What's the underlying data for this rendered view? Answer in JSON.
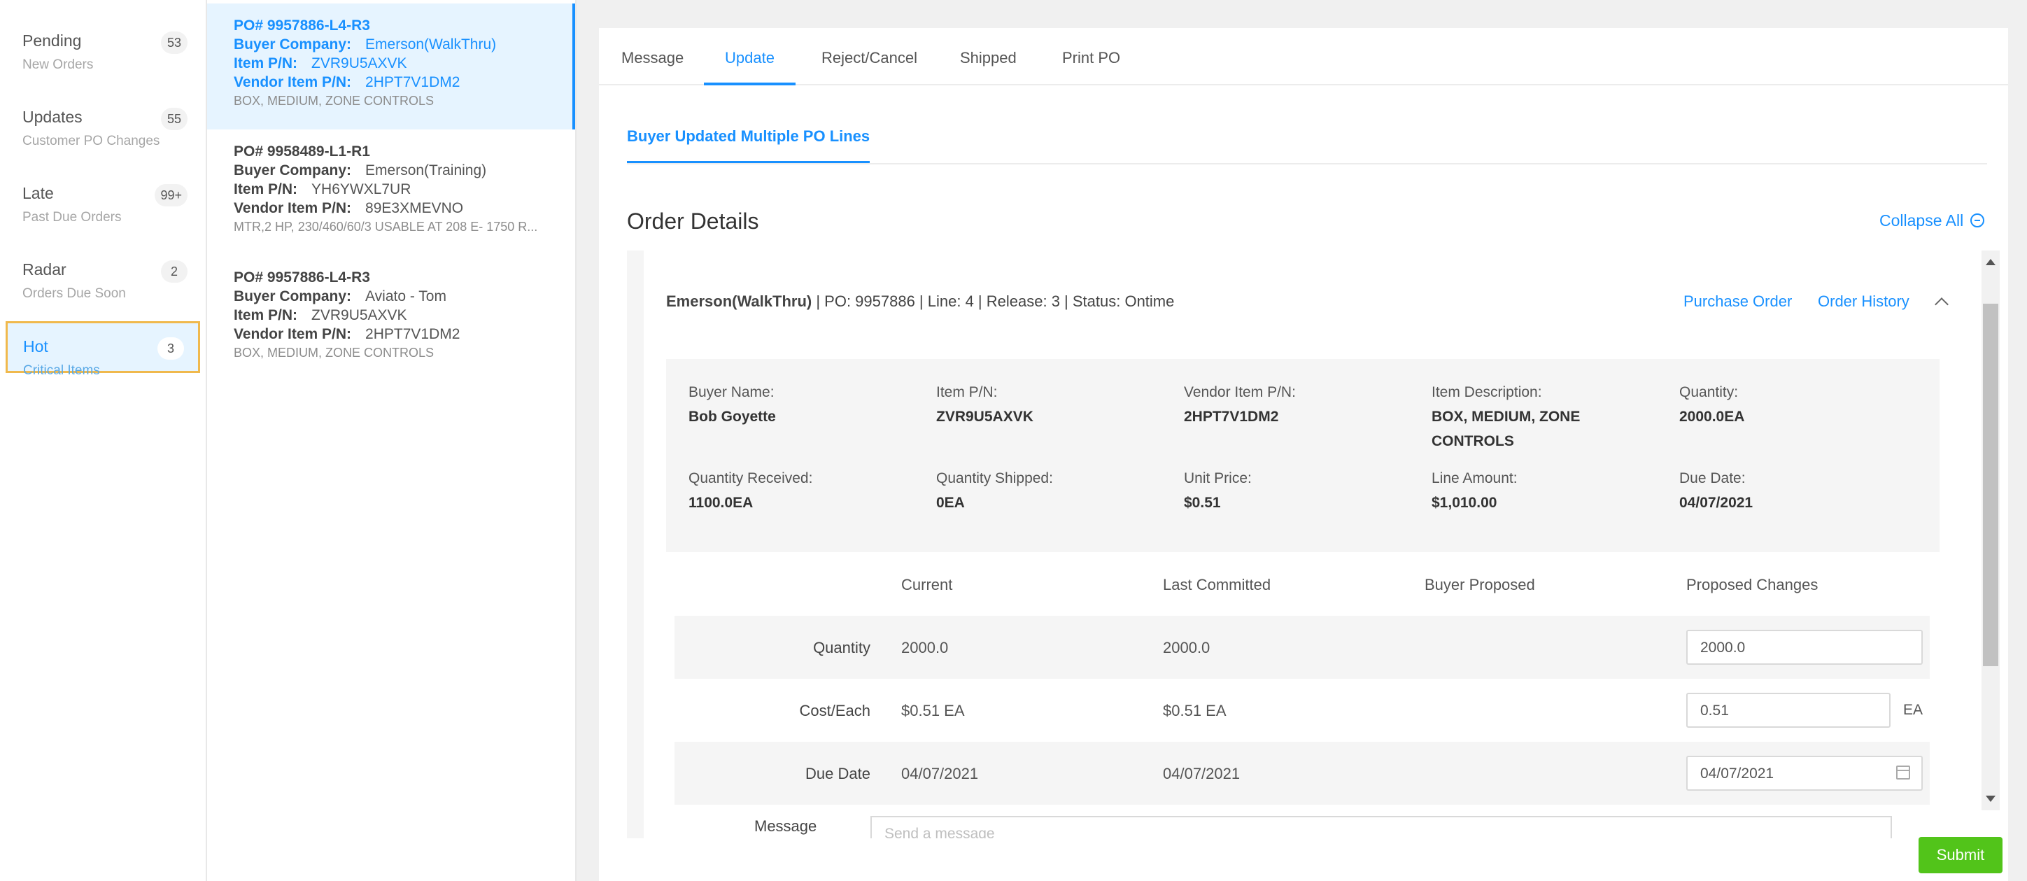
{
  "nav": {
    "items": [
      {
        "title": "Pending",
        "sub": "New Orders",
        "badge": "53"
      },
      {
        "title": "Updates",
        "sub": "Customer PO Changes",
        "badge": "55"
      },
      {
        "title": "Late",
        "sub": "Past Due Orders",
        "badge": "99+"
      },
      {
        "title": "Radar",
        "sub": "Orders Due Soon",
        "badge": "2"
      },
      {
        "title": "Hot",
        "sub": "Critical Items",
        "badge": "3"
      }
    ]
  },
  "po_list": [
    {
      "po": "PO# 9957886-L4-R3",
      "buyer_label": "Buyer Company:",
      "buyer": "Emerson(WalkThru)",
      "item_label": "Item P/N:",
      "item": "ZVR9U5AXVK",
      "vendor_label": "Vendor Item P/N:",
      "vendor": "2HPT7V1DM2",
      "desc": "BOX, MEDIUM, ZONE CONTROLS"
    },
    {
      "po": "PO# 9958489-L1-R1",
      "buyer_label": "Buyer Company:",
      "buyer": "Emerson(Training)",
      "item_label": "Item P/N:",
      "item": "YH6YWXL7UR",
      "vendor_label": "Vendor Item P/N:",
      "vendor": "89E3XMEVNO",
      "desc": "MTR,2 HP, 230/460/60/3 USABLE AT 208 E- 1750 R..."
    },
    {
      "po": "PO# 9957886-L4-R3",
      "buyer_label": "Buyer Company:",
      "buyer": "Aviato - Tom",
      "item_label": "Item P/N:",
      "item": "ZVR9U5AXVK",
      "vendor_label": "Vendor Item P/N:",
      "vendor": "2HPT7V1DM2",
      "desc": "BOX, MEDIUM, ZONE CONTROLS"
    }
  ],
  "tabs": [
    "Message",
    "Update",
    "Reject/Cancel",
    "Shipped",
    "Print PO"
  ],
  "subtab": "Buyer Updated Multiple PO Lines",
  "heading": "Order Details",
  "collapse_all": "Collapse All",
  "panel": {
    "company": "Emerson(WalkThru)",
    "summary": " | PO: 9957886 | Line: 4 | Release: 3 | Status: Ontime",
    "purchase_order": "Purchase Order",
    "order_history": "Order History"
  },
  "info": {
    "buyer_name_label": "Buyer Name:",
    "buyer_name": "Bob Goyette",
    "item_label": "Item P/N:",
    "item": "ZVR9U5AXVK",
    "vendor_label": "Vendor Item P/N:",
    "vendor": "2HPT7V1DM2",
    "desc_label": "Item Description:",
    "desc_line1": "BOX, MEDIUM, ZONE",
    "desc_line2": "CONTROLS",
    "qty_label": "Quantity:",
    "qty": "2000.0EA",
    "qty_recv_label": "Quantity Received:",
    "qty_recv": "1100.0EA",
    "qty_ship_label": "Quantity Shipped:",
    "qty_ship": "0EA",
    "unit_price_label": "Unit Price:",
    "unit_price": "$0.51",
    "line_amount_label": "Line Amount:",
    "line_amount": "$1,010.00",
    "due_label": "Due Date:",
    "due": "04/07/2021"
  },
  "compare": {
    "headers": {
      "current": "Current",
      "last": "Last Committed",
      "buyer": "Buyer Proposed",
      "proposed": "Proposed Changes"
    },
    "rows": [
      {
        "label": "Quantity",
        "current": "2000.0",
        "last": "2000.0",
        "proposed": "2000.0"
      },
      {
        "label": "Cost/Each",
        "current": "$0.51 EA",
        "last": "$0.51 EA",
        "proposed": "0.51",
        "unit": "EA"
      },
      {
        "label": "Due Date",
        "current": "04/07/2021",
        "last": "04/07/2021",
        "proposed": "04/07/2021"
      }
    ],
    "message_label": "Message",
    "message_placeholder": "Send a message"
  },
  "submit": "Submit",
  "colors": {
    "accent": "#1890ff",
    "submit": "#52c41a",
    "highlight": "#f0b94d"
  }
}
